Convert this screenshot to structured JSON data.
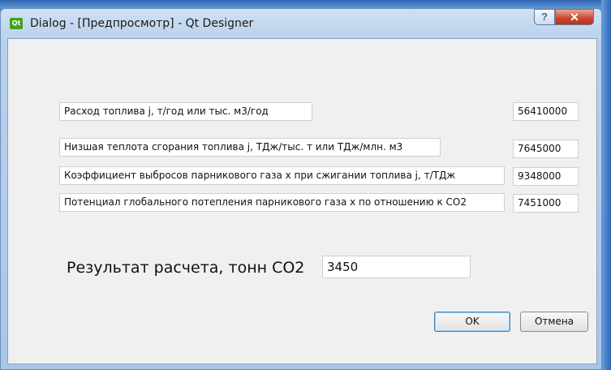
{
  "window": {
    "app_icon_text": "Qt",
    "title": "Dialog - [Предпросмотр] - Qt Designer",
    "help_glyph": "?",
    "close_glyph": "✕"
  },
  "fields": [
    {
      "label": "Расход топлива j, т/год или тыс. м3/год",
      "value": "56410000"
    },
    {
      "label": "Низшая теплота сгорания топлива j, ТДж/тыс. т или ТДж/млн. м3",
      "value": "7645000"
    },
    {
      "label": "Коэффициент выбросов парникового газа х при сжигании топлива j, т/ТДж",
      "value": "9348000"
    },
    {
      "label": "Потенциал глобального потепления парникового газа х по отношению к СО2",
      "value": "7451000"
    }
  ],
  "result": {
    "label": "Результат расчета, тонн СО2",
    "value": "3450"
  },
  "buttons": {
    "ok": "OK",
    "cancel": "Отмена"
  }
}
